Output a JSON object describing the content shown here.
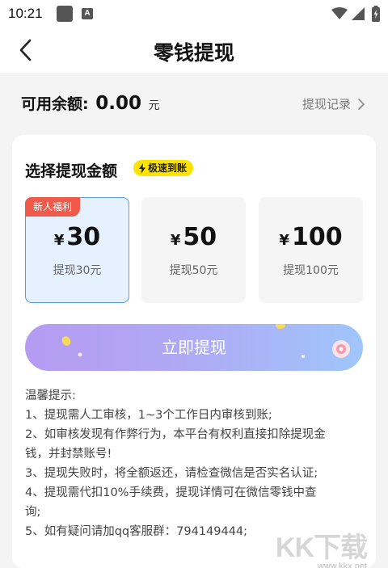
{
  "status_bar": {
    "time": "10:21",
    "a_badge": "A"
  },
  "nav": {
    "title": "零钱提现"
  },
  "balance": {
    "label": "可用余额:",
    "value": "0.00",
    "unit": "元",
    "record_link": "提现记录"
  },
  "withdraw_section": {
    "title": "选择提现金额",
    "badge": "极速到账",
    "options": [
      {
        "tag": "新人福利",
        "currency": "¥",
        "amount": "30",
        "desc": "提现30元",
        "selected": true
      },
      {
        "currency": "¥",
        "amount": "50",
        "desc": "提现50元",
        "selected": false
      },
      {
        "currency": "¥",
        "amount": "100",
        "desc": "提现100元",
        "selected": false
      }
    ],
    "button_label": "立即提现"
  },
  "tips": {
    "heading": "温馨提示:",
    "lines": [
      "1、提现需人工审核，1~3个工作日内审核到账;",
      "2、如审核发现有作弊行为，本平台有权利直接扣除提现金",
      "钱，并封禁账号!",
      "3、提现失败时，将全额返还，请检查微信是否实名认证;",
      "4、提现需代扣10%手续费，提现详情可在微信零钱中查",
      "询;",
      "5、如有疑问请加qq客服群：794149444;"
    ]
  },
  "watermark": {
    "text": "KK下载",
    "url": "www.kkx.net"
  },
  "colors": {
    "selected_bg": "#e6f1ff",
    "selected_border": "#5b9de6",
    "tag_red": "#ef5a4a",
    "badge_yellow": "#ffe400",
    "button_gradient_start": "#b59bf2",
    "button_gradient_end": "#9fc6fb"
  }
}
